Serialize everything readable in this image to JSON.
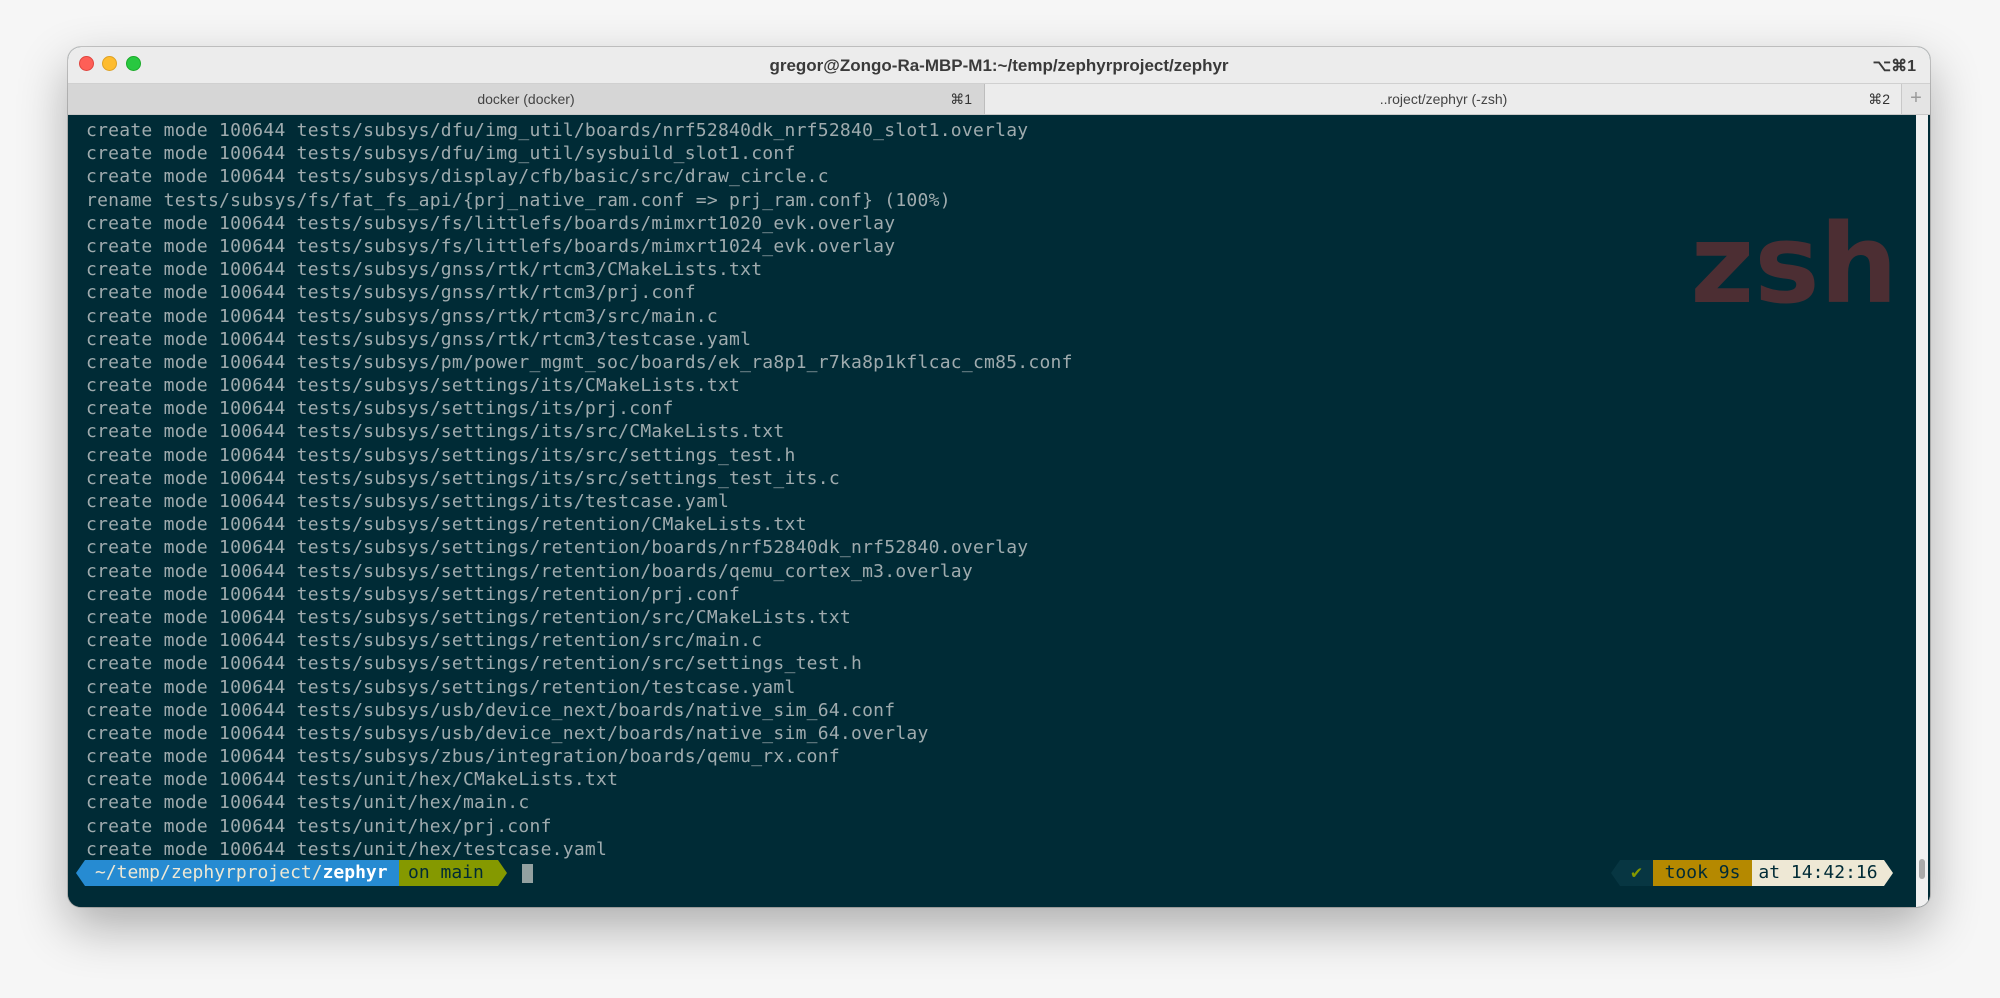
{
  "window": {
    "title": "gregor@Zongo-Ra-MBP-M1:~/temp/zephyrproject/zephyr",
    "title_shortcut": "⌥⌘1"
  },
  "tabs": [
    {
      "label": "docker (docker)",
      "shortcut": "⌘1"
    },
    {
      "label": "..roject/zephyr (-zsh)",
      "shortcut": "⌘2"
    }
  ],
  "tab_add_label": "+",
  "terminal": {
    "watermark": "zsh",
    "lines": [
      "create mode 100644 tests/subsys/dfu/img_util/boards/nrf52840dk_nrf52840_slot1.overlay",
      "create mode 100644 tests/subsys/dfu/img_util/sysbuild_slot1.conf",
      "create mode 100644 tests/subsys/display/cfb/basic/src/draw_circle.c",
      "rename tests/subsys/fs/fat_fs_api/{prj_native_ram.conf => prj_ram.conf} (100%)",
      "create mode 100644 tests/subsys/fs/littlefs/boards/mimxrt1020_evk.overlay",
      "create mode 100644 tests/subsys/fs/littlefs/boards/mimxrt1024_evk.overlay",
      "create mode 100644 tests/subsys/gnss/rtk/rtcm3/CMakeLists.txt",
      "create mode 100644 tests/subsys/gnss/rtk/rtcm3/prj.conf",
      "create mode 100644 tests/subsys/gnss/rtk/rtcm3/src/main.c",
      "create mode 100644 tests/subsys/gnss/rtk/rtcm3/testcase.yaml",
      "create mode 100644 tests/subsys/pm/power_mgmt_soc/boards/ek_ra8p1_r7ka8p1kflcac_cm85.conf",
      "create mode 100644 tests/subsys/settings/its/CMakeLists.txt",
      "create mode 100644 tests/subsys/settings/its/prj.conf",
      "create mode 100644 tests/subsys/settings/its/src/CMakeLists.txt",
      "create mode 100644 tests/subsys/settings/its/src/settings_test.h",
      "create mode 100644 tests/subsys/settings/its/src/settings_test_its.c",
      "create mode 100644 tests/subsys/settings/its/testcase.yaml",
      "create mode 100644 tests/subsys/settings/retention/CMakeLists.txt",
      "create mode 100644 tests/subsys/settings/retention/boards/nrf52840dk_nrf52840.overlay",
      "create mode 100644 tests/subsys/settings/retention/boards/qemu_cortex_m3.overlay",
      "create mode 100644 tests/subsys/settings/retention/prj.conf",
      "create mode 100644 tests/subsys/settings/retention/src/CMakeLists.txt",
      "create mode 100644 tests/subsys/settings/retention/src/main.c",
      "create mode 100644 tests/subsys/settings/retention/src/settings_test.h",
      "create mode 100644 tests/subsys/settings/retention/testcase.yaml",
      "create mode 100644 tests/subsys/usb/device_next/boards/native_sim_64.conf",
      "create mode 100644 tests/subsys/usb/device_next/boards/native_sim_64.overlay",
      "create mode 100644 tests/subsys/zbus/integration/boards/qemu_rx.conf",
      "create mode 100644 tests/unit/hex/CMakeLists.txt",
      "create mode 100644 tests/unit/hex/main.c",
      "create mode 100644 tests/unit/hex/prj.conf",
      "create mode 100644 tests/unit/hex/testcase.yaml"
    ]
  },
  "prompt": {
    "path_prefix": "~/temp/zephyrproject/",
    "path_dir": "zephyr",
    "git_branch": "on main",
    "status_ok": "✔",
    "duration": "took 9s",
    "time": "at 14:42:16"
  },
  "colors": {
    "terminal_bg": "#002b36",
    "text": "#9fabae",
    "path_segment": "#268bd2",
    "git_segment": "#859900",
    "took_segment": "#b58900",
    "time_segment": "#eee8d5",
    "watermark": "#5a2f33"
  }
}
